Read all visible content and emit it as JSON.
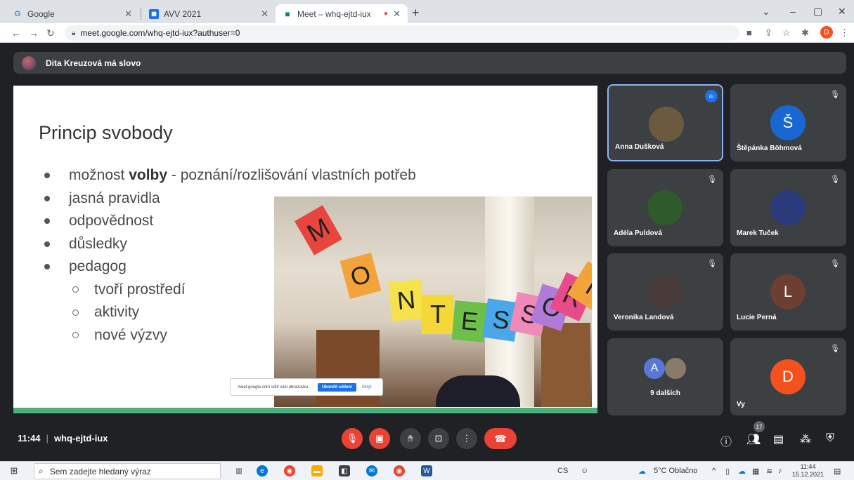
{
  "browser": {
    "tabs": [
      {
        "label": "Google",
        "favicon": "G"
      },
      {
        "label": "AVV 2021",
        "favicon": "calendar-icon"
      },
      {
        "label": "Meet – whq-ejtd-iux",
        "favicon": "meet-icon"
      }
    ],
    "url": "meet.google.com/whq-ejtd-iux?authuser=0",
    "profile_initial": "D"
  },
  "meet": {
    "banner": "Dita Kreuzová má slovo",
    "slide": {
      "title": "Princip svobody",
      "bullets": [
        {
          "pre": "možnost ",
          "bold": "volby",
          "post": " - poznání/rozlišování vlastních potřeb"
        },
        {
          "text": "jasná pravidla"
        },
        {
          "text": "odpovědnost"
        },
        {
          "text": "důsledky"
        },
        {
          "text": "pedagog"
        }
      ],
      "subbullets": [
        "tvoří prostředí",
        "aktivity",
        "nové výzvy"
      ],
      "banner_letters": [
        "M",
        "O",
        "N",
        "T",
        "E",
        "S",
        "S",
        "O",
        "R",
        "I"
      ],
      "share_notice": {
        "text": "meet.google.com sdílí vaši obrazovku.",
        "stop_label": "Ukončit sdílení",
        "hide_label": "Skrýt"
      }
    },
    "participants": [
      {
        "name": "Anna Dušková",
        "initial": "",
        "color": "#6b5a3e"
      },
      {
        "name": "Štěpánka Böhmová",
        "initial": "Š",
        "color": "#1967d2"
      },
      {
        "name": "Adéla Puldová",
        "initial": "",
        "color": "#2f5a2a"
      },
      {
        "name": "Marek Tuček",
        "initial": "",
        "color": "#2a3a7a"
      },
      {
        "name": "Veronika Landová",
        "initial": "",
        "color": "#4a3c3a"
      },
      {
        "name": "Lucie Perná",
        "initial": "L",
        "color": "#6d3f30"
      },
      {
        "name": "9 dalších",
        "initial": "A",
        "color": "#5b77d6"
      },
      {
        "name": "Vy",
        "initial": "D",
        "color": "#f4511e"
      }
    ],
    "time": "11:44",
    "meeting_code": "whq-ejtd-iux",
    "participant_count": "17"
  },
  "taskbar": {
    "search_placeholder": "Sem zadejte hledaný výraz",
    "lang": "CS",
    "weather": "5°C Oblačno",
    "clock_time": "11:44",
    "clock_date": "15.12.2021"
  }
}
